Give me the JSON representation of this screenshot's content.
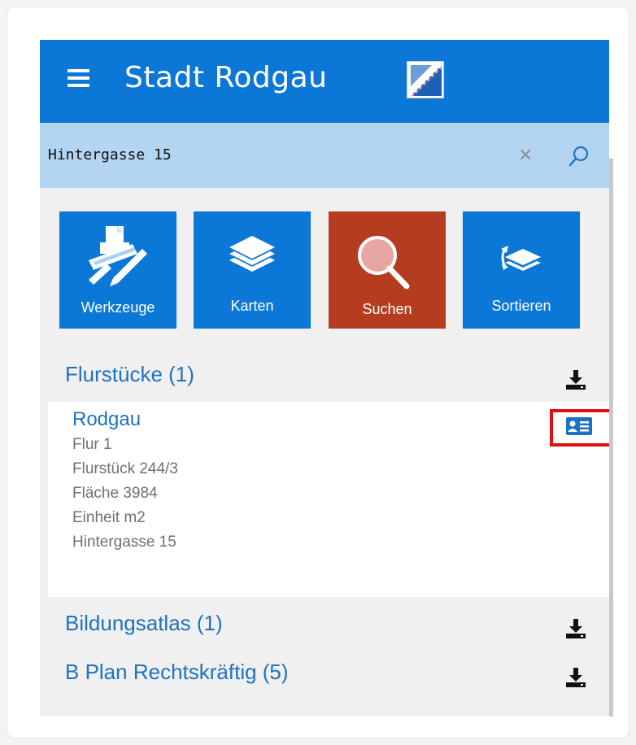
{
  "header": {
    "title": "Stadt Rodgau",
    "color": "#0b78d7"
  },
  "search": {
    "value": "Hintergasse 15",
    "placeholder": ""
  },
  "toolbar": {
    "buttons": [
      {
        "label": "Werkzeuge",
        "icon": "tools-icon",
        "color": "#0b78d7"
      },
      {
        "label": "Karten",
        "icon": "layers-icon",
        "color": "#0b78d7"
      },
      {
        "label": "Suchen",
        "icon": "search-icon",
        "color": "#b63c1f"
      },
      {
        "label": "Sortieren",
        "icon": "sort-layers-icon",
        "color": "#0b78d7"
      }
    ]
  },
  "results": {
    "sections": [
      {
        "title": "Flurstücke (1)"
      },
      {
        "title": "Bildungsatlas (1)"
      },
      {
        "title": "B Plan Rechtskräftig (5)"
      }
    ],
    "flurstueck": {
      "title": "Rodgau",
      "lines": [
        "Flur 1",
        "Flurstück 244/3",
        "Fläche 3984",
        "Einheit m2",
        "Hintergasse 15"
      ]
    }
  }
}
